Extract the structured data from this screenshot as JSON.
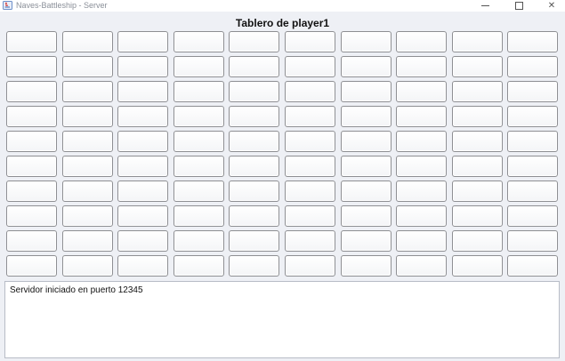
{
  "window": {
    "title": "Naves-Battleship - Server",
    "controls": {
      "minimize_icon": "minimize-icon",
      "maximize_icon": "maximize-icon",
      "close_icon": "close-icon",
      "close_glyph": "✕"
    }
  },
  "board": {
    "title": "Tablero de player1",
    "rows": 10,
    "cols": 10
  },
  "log": {
    "lines": [
      "Servidor iniciado en puerto 12345"
    ]
  },
  "colors": {
    "background": "#eef0f5",
    "cell_border": "#8e8f93",
    "log_background": "#ffffff"
  }
}
